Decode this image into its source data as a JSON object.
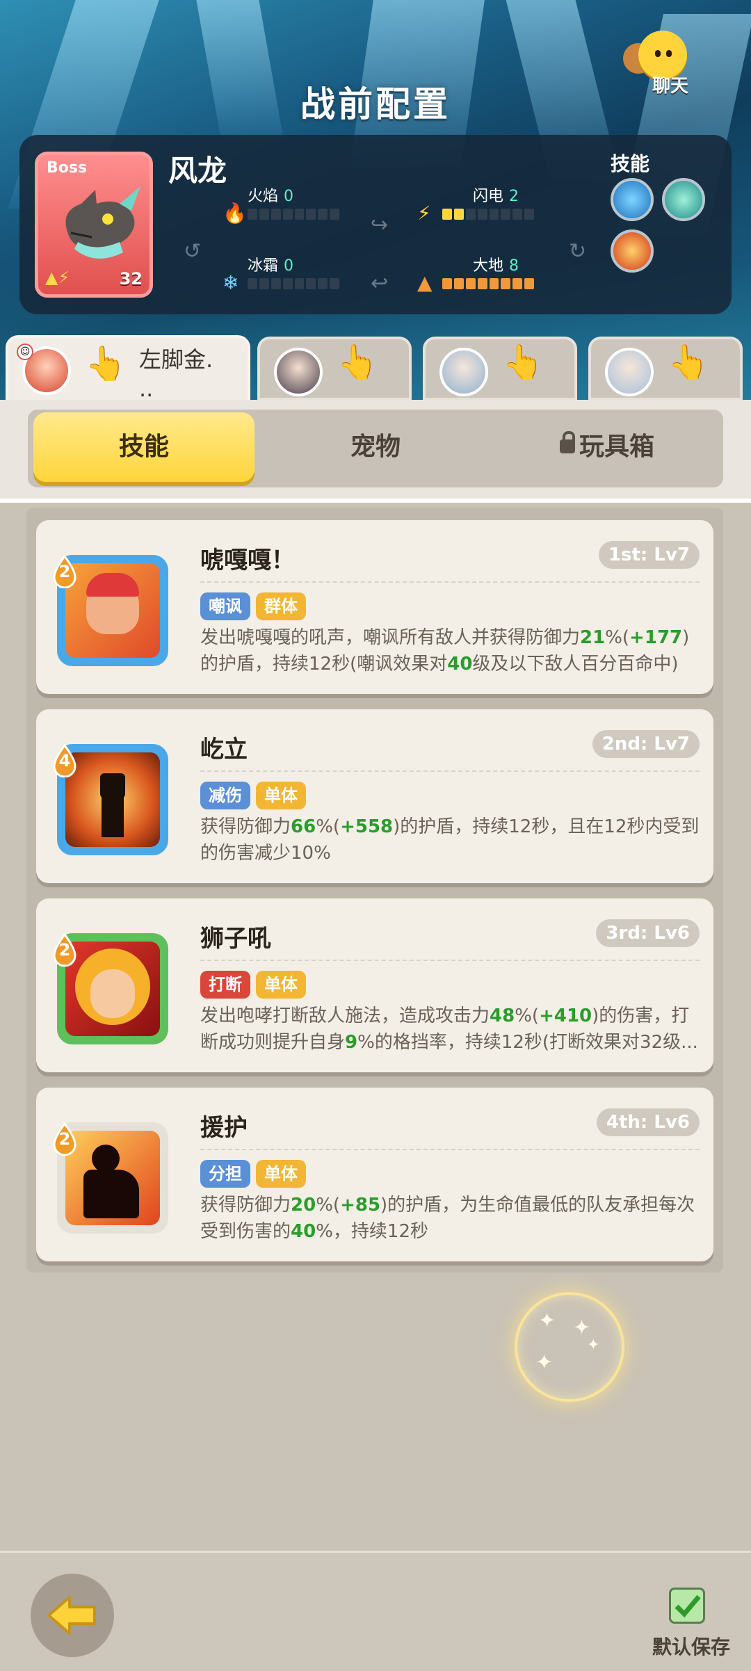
{
  "header": {
    "title": "战前配置",
    "chat_label": "聊天"
  },
  "boss": {
    "tag": "Boss",
    "name": "风龙",
    "level": "32",
    "stats": [
      {
        "label": "火焰",
        "value": "0",
        "filled": 0,
        "total": 8
      },
      {
        "label": "闪电",
        "value": "2",
        "filled": 2,
        "total": 8
      },
      {
        "label": "冰霜",
        "value": "0",
        "filled": 0,
        "total": 8
      },
      {
        "label": "大地",
        "value": "8",
        "filled": 8,
        "total": 8
      }
    ],
    "skills_label": "技能"
  },
  "heroes": [
    {
      "name": "左脚金.\n..",
      "active": true
    },
    {
      "name": "",
      "active": false
    },
    {
      "name": "",
      "active": false
    },
    {
      "name": "",
      "active": false
    }
  ],
  "tabs": {
    "skill": "技能",
    "pet": "宠物",
    "toybox": "玩具箱",
    "selected": "skill"
  },
  "skills": [
    {
      "cost": "2",
      "name": "唬嘎嘎！",
      "level": "1st: Lv7",
      "tags": [
        "嘲讽",
        "群体"
      ],
      "desc_parts": [
        "发出唬嘎嘎的吼声，嘲讽所有敌人并获得防御力",
        "21",
        "%(",
        "+177",
        ")的护盾，持续12秒(嘲讽效果对",
        "40",
        "级及以下敌人百分百命中)"
      ]
    },
    {
      "cost": "4",
      "name": "屹立",
      "level": "2nd: Lv7",
      "tags": [
        "减伤",
        "单体"
      ],
      "desc_parts": [
        "获得防御力",
        "66",
        "%(",
        "+558",
        ")的护盾，持续12秒，且在12秒内受到的伤害减少10%",
        "",
        ""
      ]
    },
    {
      "cost": "2",
      "name": "狮子吼",
      "level": "3rd: Lv6",
      "tags": [
        "打断",
        "单体"
      ],
      "desc_parts": [
        "发出咆哮打断敌人施法，造成攻击力",
        "48",
        "%(",
        "+410",
        ")的伤害，打断成功则提升自身",
        "9",
        "%的格挡率，持续12秒(打断效果对32级..."
      ]
    },
    {
      "cost": "2",
      "name": "援护",
      "level": "4th: Lv6",
      "tags": [
        "分担",
        "单体"
      ],
      "desc_parts": [
        "获得防御力",
        "20",
        "%(",
        "+85",
        ")的护盾，为生命值最低的队友承担每次受到伤害的",
        "40",
        "%，持续12秒"
      ]
    }
  ],
  "footer": {
    "save_label": "默认保存"
  }
}
